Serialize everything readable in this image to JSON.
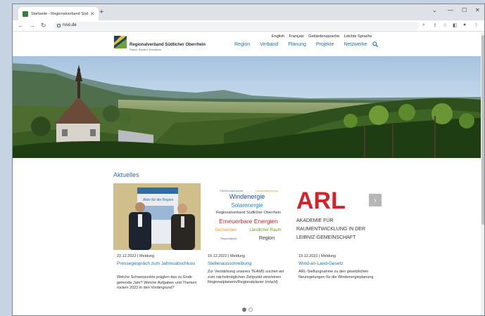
{
  "browser": {
    "tab_title": "Startseite - Regionalverband Südl",
    "url": "rvso.de",
    "colors": {
      "tabbar": "#dee1e6",
      "page_bg": "#ffffff"
    }
  },
  "header": {
    "lang_links": [
      "English",
      "Français",
      "Gebärdensprache",
      "Leichte Sprache"
    ],
    "logo_name": "Regionalverband Südlicher Oberrhein",
    "logo_sub": "Planen. Beraten. Entwickeln.",
    "nav_items": [
      "Region",
      "Verband",
      "Planung",
      "Projekte",
      "Netzwerke"
    ],
    "accent_color": "#2b6ea3"
  },
  "news": {
    "title": "Aktuelles",
    "items": [
      {
        "date": "22.12.2022 | Meldung",
        "title": "Pressegespräch zum Jahresabschluss",
        "text": "Welche Schwerpunkte prägten das zu Ende gehende Jahr? Welche Aufgaben und Themen rücken 2023 in den Vordergrund?",
        "image": "two-men-photo",
        "banner_text": "Aktiv für die Region"
      },
      {
        "date": "19.12.2022 | Meldung",
        "title": "Stellenausschreibung",
        "text": "Zur Verstärkung unseres TEAMS suchen wir zum nächstmöglichen Zeitpunkt eine/einen Regionalplanerin/Regionalplaner (m/w/d)",
        "image": "word-cloud",
        "cloud_words": [
          "Windenergie",
          "Solarenergie",
          "Regionalverband Südlicher Oberrhein",
          "Erneuerbare Energien",
          "Gemeinden",
          "Ländlicher Raum",
          "Region",
          "Regionalplan",
          "Flächennutzungsplan",
          "Landschaftsplanung"
        ]
      },
      {
        "date": "19.12.2022 | Meldung",
        "title": "Wind-an-Land-Gesetz",
        "text": "ARL-Stellungnahme zu den gesetzlichen Neuregelungen für die Windenergieplanung",
        "image": "arl-logo",
        "arl_big": "ARL",
        "arl_lines": [
          "AKADEMIE FÜR",
          "RAUMENTWICKLUNG IN DER",
          "LEIBNIZ-GEMEINSCHAFT"
        ]
      }
    ],
    "next_label": "›"
  }
}
